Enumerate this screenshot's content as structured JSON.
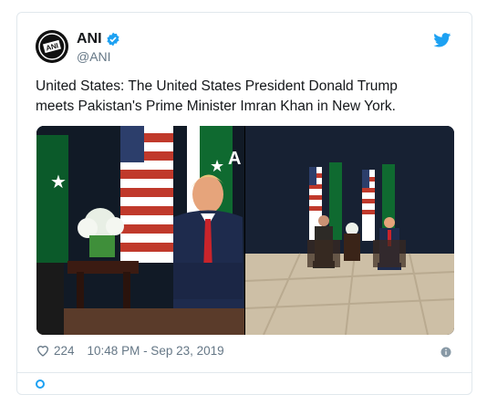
{
  "tweet": {
    "display_name": "ANI",
    "handle": "@ANI",
    "avatar_text": "ANI",
    "text": "United States: The United States President Donald Trump\nmeets Pakistan's Prime Minister Imran Khan in New York.",
    "likes": "224",
    "timestamp": "10:48 PM - Sep 23, 2019",
    "media_overlay_text": "A"
  },
  "colors": {
    "twitter_blue": "#1da1f2",
    "text_primary": "#14171a",
    "text_secondary": "#657786",
    "border": "#e1e8ed"
  },
  "icons": {
    "verified": "verified-badge-icon",
    "bird": "twitter-bird-icon",
    "like": "heart-icon",
    "info": "info-icon"
  }
}
